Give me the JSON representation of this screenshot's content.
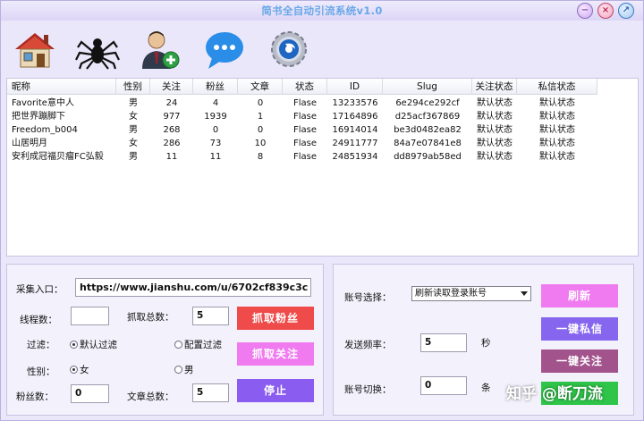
{
  "window": {
    "title": "简书全自动引流系统v1.0",
    "controls": {
      "minimize": "−",
      "close": "×",
      "maximize": "↗"
    }
  },
  "toolbar": {
    "icons": [
      "home-icon",
      "spider-icon",
      "add-user-icon",
      "chat-bubble-icon",
      "settings-gear-icon"
    ]
  },
  "table": {
    "headers": [
      "昵称",
      "性别",
      "关注",
      "粉丝",
      "文章",
      "状态",
      "ID",
      "Slug",
      "关注状态",
      "私信状态"
    ],
    "rows": [
      [
        "Favorite意中人",
        "男",
        "24",
        "4",
        "0",
        "Flase",
        "13233576",
        "6e294ce292cf",
        "默认状态",
        "默认状态"
      ],
      [
        "把世界蹦脚下",
        "女",
        "977",
        "1939",
        "1",
        "Flase",
        "17164896",
        "d25acf367869",
        "默认状态",
        "默认状态"
      ],
      [
        "Freedom_b004",
        "男",
        "268",
        "0",
        "0",
        "Flase",
        "16914014",
        "be3d0482ea82",
        "默认状态",
        "默认状态"
      ],
      [
        "山居明月",
        "女",
        "286",
        "73",
        "10",
        "Flase",
        "24911777",
        "84a7e07841e8",
        "默认状态",
        "默认状态"
      ],
      [
        "安利成冠福贝瘤FC弘毅",
        "男",
        "11",
        "11",
        "8",
        "Flase",
        "24851934",
        "dd8979ab58ed",
        "默认状态",
        "默认状态"
      ]
    ]
  },
  "collect": {
    "entry_label": "采集入口：",
    "entry_value": "https://www.jianshu.com/u/6702cf839c3c",
    "threads_label": "线程数：",
    "threads_value": "",
    "total_label": "抓取总数：",
    "total_value": "5",
    "fetch_fans_button": "抓取粉丝",
    "fetch_follow_button": "抓取关注",
    "stop_button": "停止",
    "filter_label": "过滤：",
    "filter_default": "默认过滤",
    "filter_config": "配置过滤",
    "gender_label": "性别：",
    "gender_female": "女",
    "gender_male": "男",
    "fans_label": "粉丝数：",
    "fans_value": "0",
    "articles_label": "文章总数：",
    "articles_value": "5"
  },
  "account": {
    "select_label": "账号选择：",
    "select_value": "刷新读取登录账号",
    "refresh_button": "刷新",
    "freq_label": "发送频率：",
    "freq_value": "5",
    "freq_unit": "秒",
    "message_button": "一键私信",
    "follow_button": "一键关注",
    "switch_label": "账号切换：",
    "switch_value": "0",
    "switch_unit": "条"
  },
  "watermark": "知乎 @断刀流"
}
